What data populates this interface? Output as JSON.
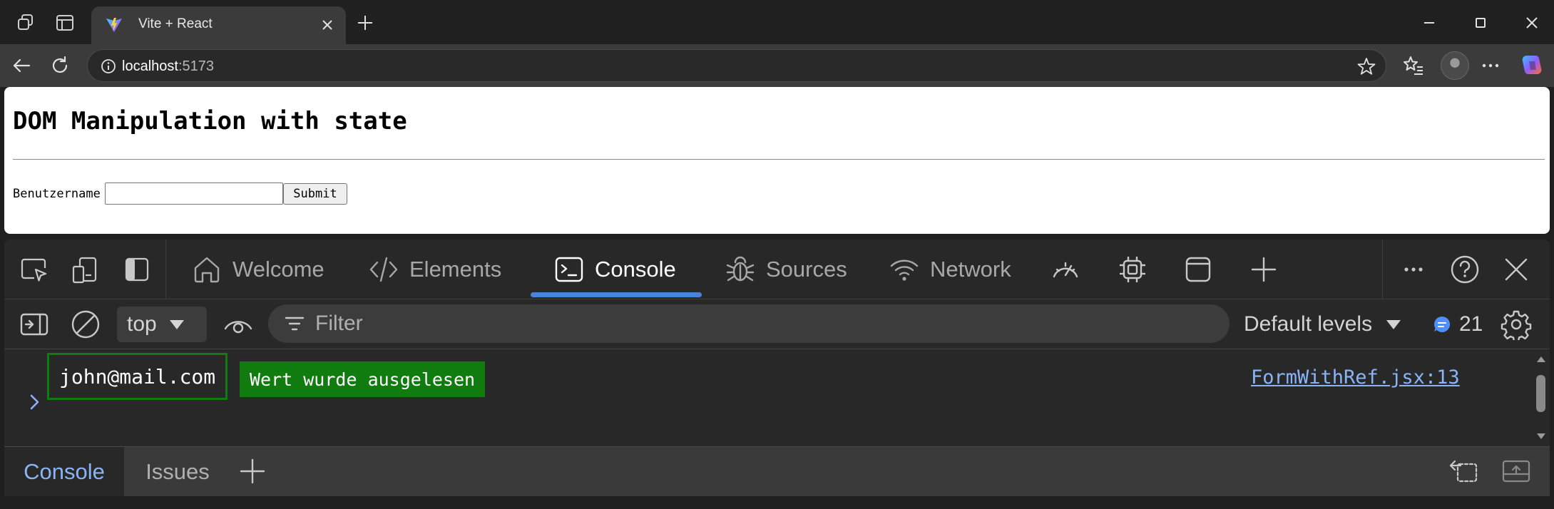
{
  "browser": {
    "tab_title": "Vite + React",
    "url_host": "localhost",
    "url_port": ":5173"
  },
  "page": {
    "heading": "DOM Manipulation with state",
    "username_label": "Benutzername",
    "username_value": "",
    "submit_label": "Submit"
  },
  "devtools": {
    "tabs": [
      {
        "label": "Welcome",
        "icon": "home-icon"
      },
      {
        "label": "Elements",
        "icon": "code-icon"
      },
      {
        "label": "Console",
        "icon": "console-icon",
        "active": true
      },
      {
        "label": "Sources",
        "icon": "bug-icon"
      },
      {
        "label": "Network",
        "icon": "wifi-icon"
      }
    ],
    "context": "top",
    "filter_placeholder": "Filter",
    "levels_label": "Default levels",
    "message_count": "21",
    "log": {
      "email": "john@mail.com",
      "message": "Wert wurde ausgelesen",
      "source": "FormWithRef.jsx:13"
    },
    "drawer_tabs": [
      "Console",
      "Issues"
    ]
  },
  "colors": {
    "accent": "#4a84d9",
    "log_green": "#107c10",
    "link_blue": "#8ab4f8"
  }
}
